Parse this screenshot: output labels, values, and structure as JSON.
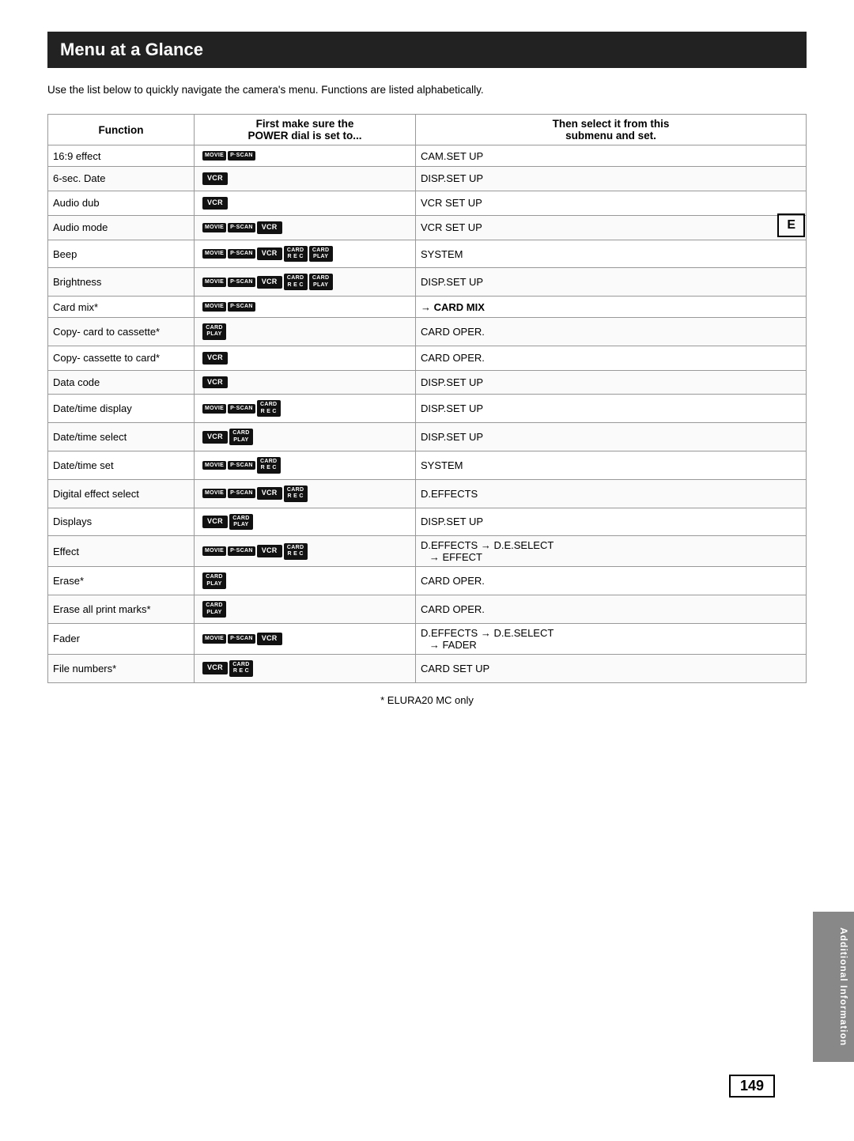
{
  "page": {
    "title": "Menu at a Glance",
    "intro": "Use the list below to quickly navigate the camera's menu. Functions are listed alphabetically.",
    "e_label": "E",
    "page_number": "149",
    "footer_note": "* ELURA20 MC only",
    "additional_info": "Additional Information"
  },
  "table": {
    "header": {
      "function": "Function",
      "power_line1": "First make sure the",
      "power_line2": "POWER dial is set to...",
      "submenu_line1": "Then select it from this",
      "submenu_line2": "submenu and set."
    },
    "rows": [
      {
        "function": "16:9 effect",
        "badges": [
          "MOVIE",
          "P.SCAN"
        ],
        "submenu": "CAM.SET UP"
      },
      {
        "function": "6-sec. Date",
        "badges": [
          "VCR"
        ],
        "submenu": "DISP.SET UP"
      },
      {
        "function": "Audio dub",
        "badges": [
          "VCR"
        ],
        "submenu": "VCR SET UP"
      },
      {
        "function": "Audio mode",
        "badges": [
          "MOVIE",
          "P.SCAN",
          "VCR"
        ],
        "submenu": "VCR SET UP"
      },
      {
        "function": "Beep",
        "badges": [
          "MOVIE",
          "P.SCAN",
          "VCR",
          "CARD REC",
          "CARD PLAY"
        ],
        "submenu": "SYSTEM"
      },
      {
        "function": "Brightness",
        "badges": [
          "MOVIE",
          "P.SCAN",
          "VCR",
          "CARD REC",
          "CARD PLAY"
        ],
        "submenu": "DISP.SET UP"
      },
      {
        "function": "Card mix*",
        "badges": [
          "MOVIE",
          "P.SCAN"
        ],
        "submenu": "→ CARD MIX"
      },
      {
        "function": "Copy- card to cassette*",
        "badges": [
          "CARD PLAY"
        ],
        "submenu": "CARD OPER."
      },
      {
        "function": "Copy- cassette to card*",
        "badges": [
          "VCR"
        ],
        "submenu": "CARD OPER."
      },
      {
        "function": "Data code",
        "badges": [
          "VCR"
        ],
        "submenu": "DISP.SET UP"
      },
      {
        "function": "Date/time display",
        "badges": [
          "MOVIE",
          "P.SCAN",
          "CARD REC"
        ],
        "submenu": "DISP.SET UP"
      },
      {
        "function": "Date/time select",
        "badges": [
          "VCR",
          "CARD PLAY"
        ],
        "submenu": "DISP.SET UP"
      },
      {
        "function": "Date/time set",
        "badges": [
          "MOVIE",
          "P.SCAN",
          "CARD REC"
        ],
        "submenu": "SYSTEM"
      },
      {
        "function": "Digital effect select",
        "badges": [
          "MOVIE",
          "P.SCAN",
          "VCR",
          "CARD REC"
        ],
        "submenu": "D.EFFECTS"
      },
      {
        "function": "Displays",
        "badges": [
          "VCR",
          "CARD PLAY"
        ],
        "submenu": "DISP.SET UP"
      },
      {
        "function": "Effect",
        "badges": [
          "MOVIE",
          "P.SCAN",
          "VCR",
          "CARD REC"
        ],
        "submenu": "D.EFFECTS → D.E.SELECT → EFFECT"
      },
      {
        "function": "Erase*",
        "badges": [
          "CARD PLAY"
        ],
        "submenu": "CARD OPER."
      },
      {
        "function": "Erase all print marks*",
        "badges": [
          "CARD PLAY"
        ],
        "submenu": "CARD OPER."
      },
      {
        "function": "Fader",
        "badges": [
          "MOVIE",
          "P.SCAN",
          "VCR"
        ],
        "submenu": "D.EFFECTS → D.E.SELECT → FADER"
      },
      {
        "function": "File numbers*",
        "badges": [
          "VCR",
          "CARD REC"
        ],
        "submenu": "CARD SET UP"
      }
    ]
  }
}
